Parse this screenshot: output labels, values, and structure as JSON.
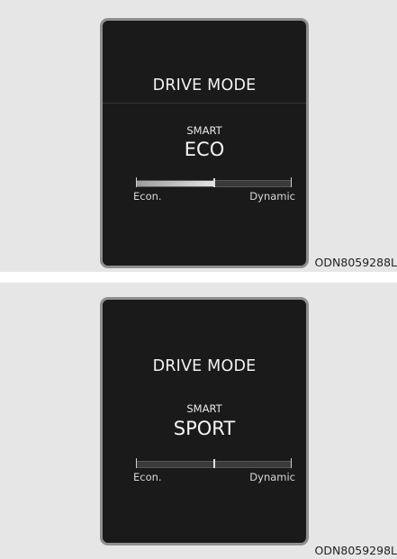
{
  "figures": [
    {
      "title": "DRIVE MODE",
      "mode_prefix": "SMART",
      "mode_name": "ECO",
      "gauge": {
        "left_label": "Econ.",
        "right_label": "Dynamic",
        "level": 0.5
      },
      "figure_code": "ODN8059288L"
    },
    {
      "title": "DRIVE MODE",
      "mode_prefix": "SMART",
      "mode_name": "SPORT",
      "gauge": {
        "left_label": "Econ.",
        "right_label": "Dynamic",
        "level": 0.5
      },
      "figure_code": "ODN8059298L"
    }
  ],
  "colors": {
    "screen_bg": "#1a1a1a",
    "bezel": "#8e8e8e",
    "panel_bg": "#e6e6e6",
    "text": "#f2f2f2",
    "gauge_fill": "#e4e4e4",
    "gauge_track": "#3a3a3a"
  }
}
